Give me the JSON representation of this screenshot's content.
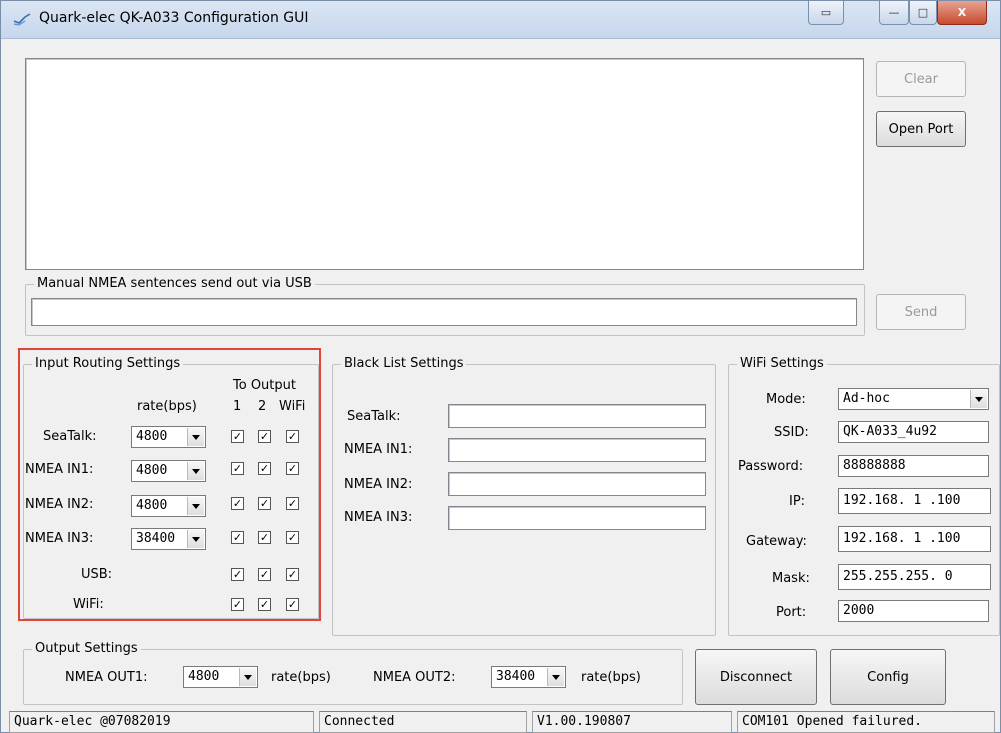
{
  "window": {
    "title": "Quark-elec QK-A033 Configuration GUI",
    "minimize": "—",
    "maximize": "□",
    "close": "X",
    "extra": "▭"
  },
  "log": {
    "text": ""
  },
  "buttons": {
    "clear": "Clear",
    "open_port": "Open Port",
    "send": "Send",
    "disconnect": "Disconnect",
    "config": "Config"
  },
  "manual": {
    "legend": "Manual NMEA sentences send out via USB",
    "value": ""
  },
  "input_routing": {
    "legend": "Input Routing Settings",
    "to_output": "To Output",
    "rate_header": "rate(bps)",
    "col1": "1",
    "col2": "2",
    "col3": "WiFi",
    "rows": [
      {
        "label": "SeaTalk:",
        "rate": "4800",
        "checks": [
          "✓",
          "✓",
          "✓"
        ]
      },
      {
        "label": "NMEA IN1:",
        "rate": "4800",
        "checks": [
          "✓",
          "✓",
          "✓"
        ]
      },
      {
        "label": "NMEA IN2:",
        "rate": "4800",
        "checks": [
          "✓",
          "✓",
          "✓"
        ]
      },
      {
        "label": "NMEA IN3:",
        "rate": "38400",
        "checks": [
          "✓",
          "✓",
          "✓"
        ]
      },
      {
        "label": "USB:",
        "rate": "",
        "checks": [
          "✓",
          "✓",
          "✓"
        ]
      },
      {
        "label": "WiFi:",
        "rate": "",
        "checks": [
          "✓",
          "✓",
          "✓"
        ]
      }
    ]
  },
  "black_list": {
    "legend": "Black List Settings",
    "rows": [
      {
        "label": "SeaTalk:",
        "value": ""
      },
      {
        "label": "NMEA IN1:",
        "value": ""
      },
      {
        "label": "NMEA IN2:",
        "value": ""
      },
      {
        "label": "NMEA IN3:",
        "value": ""
      }
    ]
  },
  "wifi": {
    "legend": "WiFi Settings",
    "mode_label": "Mode:",
    "mode": "Ad-hoc",
    "ssid_label": "SSID:",
    "ssid": "QK-A033_4u92",
    "password_label": "Password:",
    "password": "88888888",
    "ip_label": "IP:",
    "ip": "192.168. 1 .100",
    "gateway_label": "Gateway:",
    "gateway": "192.168. 1 .100",
    "mask_label": "Mask:",
    "mask": "255.255.255. 0",
    "port_label": "Port:",
    "port": "2000"
  },
  "output": {
    "legend": "Output Settings",
    "out1_label": "NMEA OUT1:",
    "out1_rate": "4800",
    "out1_unit": "rate(bps)",
    "out2_label": "NMEA OUT2:",
    "out2_rate": "38400",
    "out2_unit": "rate(bps)"
  },
  "status": {
    "company": "Quark-elec @07082019",
    "connection": "Connected",
    "version": "V1.00.190807",
    "message": "COM101 Opened failured."
  }
}
